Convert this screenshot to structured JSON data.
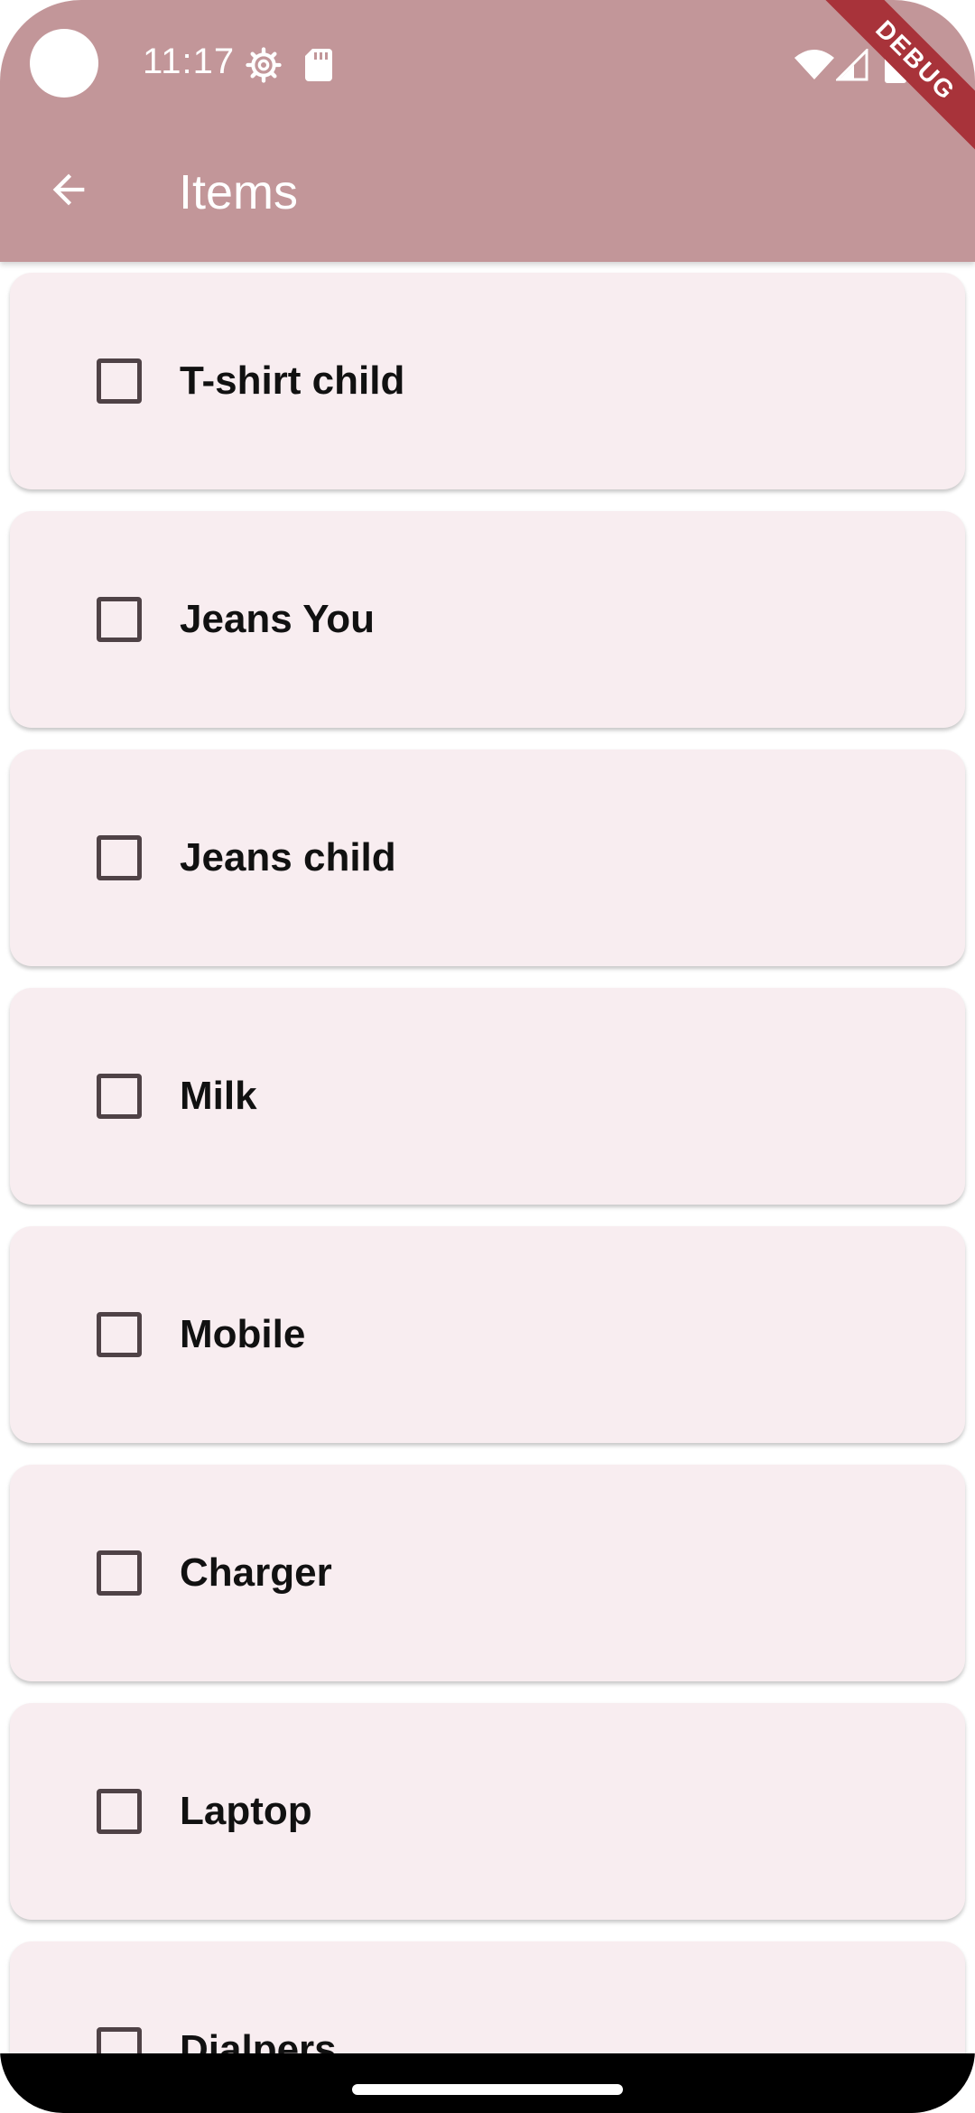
{
  "status_bar": {
    "time": "11:17"
  },
  "app_bar": {
    "title": "Items",
    "back_icon": "arrow-left-icon",
    "background_color": "#c29699"
  },
  "debug_banner": {
    "label": "DEBUG",
    "color": "#a8333a"
  },
  "items": [
    {
      "label": "T-shirt child",
      "checked": false
    },
    {
      "label": "Jeans You",
      "checked": false
    },
    {
      "label": "Jeans child",
      "checked": false
    },
    {
      "label": "Milk",
      "checked": false
    },
    {
      "label": "Mobile",
      "checked": false
    },
    {
      "label": "Charger",
      "checked": false
    },
    {
      "label": "Laptop",
      "checked": false
    },
    {
      "label": "Dialpers",
      "checked": false
    }
  ],
  "colors": {
    "card_background": "#f8edf0",
    "checkbox_border": "#4f4246"
  }
}
